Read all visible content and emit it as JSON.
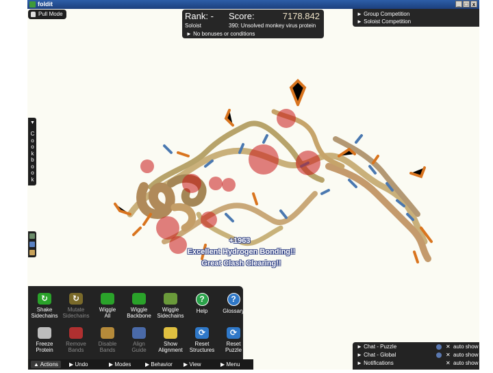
{
  "window": {
    "title": "foldit",
    "min": "_",
    "max": "□",
    "close": "x"
  },
  "pull_mode": {
    "label": "Pull Mode"
  },
  "score_panel": {
    "rank": "Rank: -",
    "score_label": "Score:",
    "score_value": "7178.842",
    "player_mode": "Soloist",
    "puzzle": "390: Unsolved monkey virus protein",
    "bonuses": "► No bonuses or conditions"
  },
  "competition": {
    "group": "► Group Competition",
    "soloist": "► Soloist Competition"
  },
  "cookbook": {
    "toggle": "▼",
    "label": "Cookbook"
  },
  "messages": {
    "points": "+1963",
    "hbond": "Excellent Hydrogen Bonding!!",
    "clash": "Great Clash Clearing!!"
  },
  "actions": {
    "row1": [
      {
        "label": "Shake\nSidechains",
        "icon": "shake-icon",
        "dim": false
      },
      {
        "label": "Mutate\nSidechains",
        "icon": "mutate-icon",
        "dim": true
      },
      {
        "label": "Wiggle\nAll",
        "icon": "wiggle-all-icon",
        "dim": false
      },
      {
        "label": "Wiggle\nBackbone",
        "icon": "wiggle-backbone-icon",
        "dim": false
      },
      {
        "label": "Wiggle\nSidechains",
        "icon": "wiggle-sidechains-icon",
        "dim": false
      },
      {
        "label": "Help",
        "icon": "help-icon",
        "dim": false
      },
      {
        "label": "Glossary",
        "icon": "glossary-icon",
        "dim": false
      }
    ],
    "row2": [
      {
        "label": "Freeze\nProtein",
        "icon": "freeze-icon",
        "dim": false
      },
      {
        "label": "Remove\nBands",
        "icon": "scissors-icon",
        "dim": true
      },
      {
        "label": "Disable\nBands",
        "icon": "broom-icon",
        "dim": true
      },
      {
        "label": "Align\nGuide",
        "icon": "align-guide-icon",
        "dim": true
      },
      {
        "label": "Show\nAlignment",
        "icon": "alignment-face-icon",
        "dim": false
      },
      {
        "label": "Reset\nStructures",
        "icon": "reset-structures-icon",
        "dim": false
      },
      {
        "label": "Reset\nPuzzle",
        "icon": "reset-puzzle-icon",
        "dim": false
      }
    ]
  },
  "bottom_tabs": [
    "▲ Actions",
    "▶ Undo",
    "▶ Modes",
    "▶ Behavior",
    "▶ View",
    "▶ Menu"
  ],
  "notifications": [
    {
      "label": "► Chat - Puzzle",
      "auto": "auto show",
      "x": "✕",
      "info": true
    },
    {
      "label": "► Chat - Global",
      "auto": "auto show",
      "x": "✕",
      "info": true
    },
    {
      "label": "► Notifications",
      "auto": "auto show",
      "x": "✕",
      "info": false
    }
  ],
  "colors": {
    "backbone": "#c9b07a",
    "helix": "#b08a5a",
    "sidechain": "#d9741e",
    "hbond": "#4a78b0",
    "clash": "#c81818",
    "green_action": "#2aa32a",
    "blue_action": "#2f78c8",
    "help": "#2aa34a"
  }
}
